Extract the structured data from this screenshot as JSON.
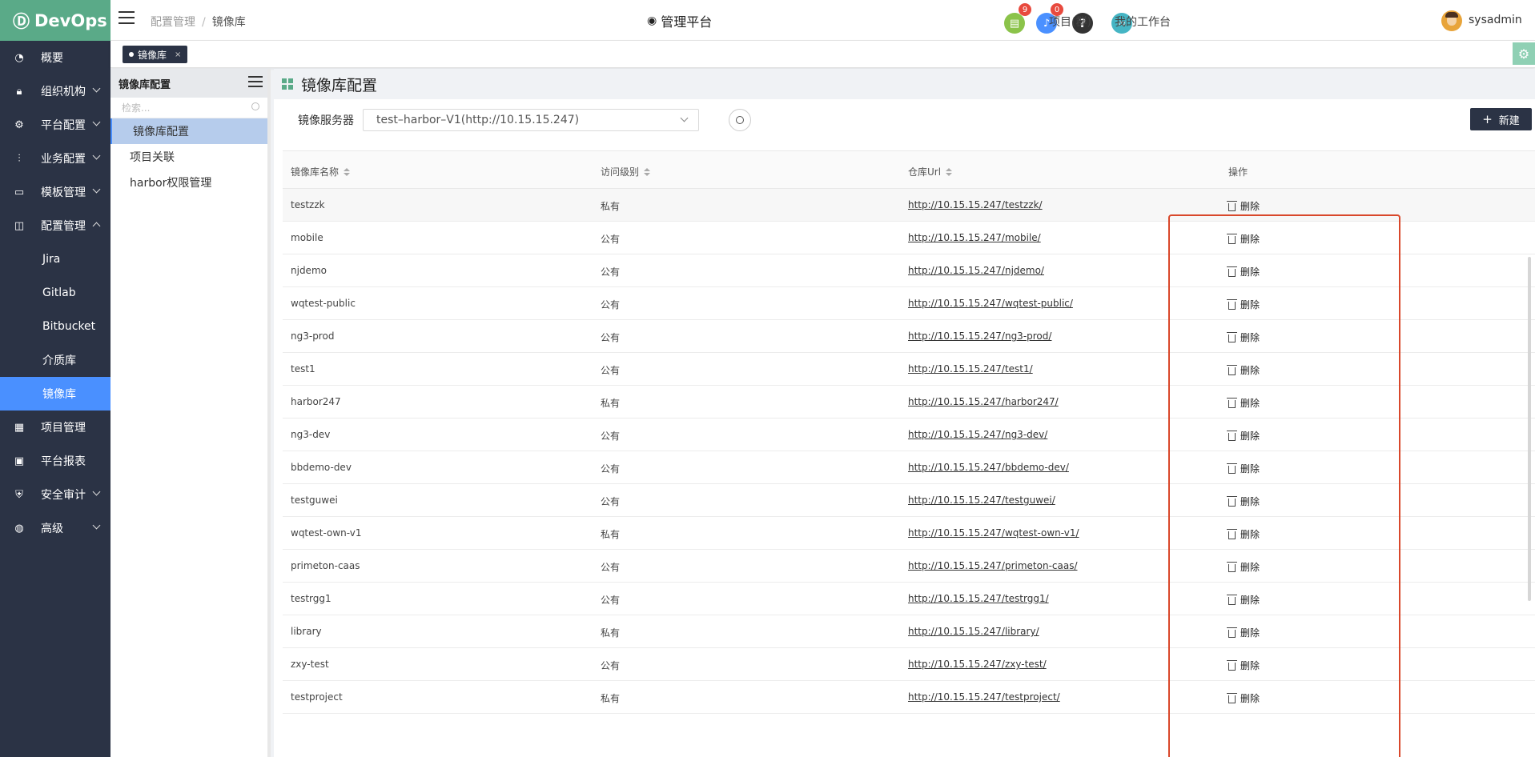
{
  "logo": {
    "text": "DevOps"
  },
  "nav": {
    "items": [
      {
        "label": "概要",
        "icon": "dashboard-icon",
        "chevron": ""
      },
      {
        "label": "组织机构",
        "icon": "lock-icon",
        "chevron": "down"
      },
      {
        "label": "平台配置",
        "icon": "gear-icon",
        "chevron": "down"
      },
      {
        "label": "业务配置",
        "icon": "sliders-icon",
        "chevron": "down"
      },
      {
        "label": "模板管理",
        "icon": "template-icon",
        "chevron": "down"
      },
      {
        "label": "配置管理",
        "icon": "database-icon",
        "chevron": "up"
      }
    ],
    "sub_items": [
      "Jira",
      "Gitlab",
      "Bitbucket",
      "介质库",
      "镜像库"
    ],
    "items_after": [
      {
        "label": "项目管理",
        "icon": "grid-icon",
        "chevron": ""
      },
      {
        "label": "平台报表",
        "icon": "monitor-icon",
        "chevron": ""
      },
      {
        "label": "安全审计",
        "icon": "shield-icon",
        "chevron": "down"
      },
      {
        "label": "高级",
        "icon": "palette-icon",
        "chevron": "down"
      }
    ]
  },
  "header": {
    "breadcrumb_parent": "配置管理",
    "breadcrumb_sep": "/",
    "breadcrumb_current": "镜像库",
    "platform_title": "管理平台",
    "doc_badge": "9",
    "bell_badge": "0",
    "projects_link": "项目(群)",
    "workspace_link": "我的工作台",
    "username": "sysadmin"
  },
  "tabs": {
    "active_tab": "镜像库",
    "close": "×"
  },
  "subpanel": {
    "title": "镜像库配置",
    "search_placeholder": "检索...",
    "links": [
      "镜像库配置",
      "项目关联",
      "harbor权限管理"
    ]
  },
  "main": {
    "title": "镜像库配置",
    "filter_label": "镜像服务器",
    "server_value": "test–harbor–V1(http://10.15.15.247)",
    "new_button": "新建",
    "columns": [
      "镜像库名称",
      "访问级别",
      "仓库Url",
      "操作"
    ],
    "delete_label": "删除",
    "rows": [
      {
        "name": "testzzk",
        "level": "私有",
        "url": "http://10.15.15.247/testzzk/"
      },
      {
        "name": "mobile",
        "level": "公有",
        "url": "http://10.15.15.247/mobile/"
      },
      {
        "name": "njdemo",
        "level": "公有",
        "url": "http://10.15.15.247/njdemo/"
      },
      {
        "name": "wqtest-public",
        "level": "公有",
        "url": "http://10.15.15.247/wqtest-public/"
      },
      {
        "name": "ng3-prod",
        "level": "公有",
        "url": "http://10.15.15.247/ng3-prod/"
      },
      {
        "name": "test1",
        "level": "公有",
        "url": "http://10.15.15.247/test1/"
      },
      {
        "name": "harbor247",
        "level": "私有",
        "url": "http://10.15.15.247/harbor247/"
      },
      {
        "name": "ng3-dev",
        "level": "公有",
        "url": "http://10.15.15.247/ng3-dev/"
      },
      {
        "name": "bbdemo-dev",
        "level": "公有",
        "url": "http://10.15.15.247/bbdemo-dev/"
      },
      {
        "name": "testguwei",
        "level": "公有",
        "url": "http://10.15.15.247/testguwei/"
      },
      {
        "name": "wqtest-own-v1",
        "level": "私有",
        "url": "http://10.15.15.247/wqtest-own-v1/"
      },
      {
        "name": "primeton-caas",
        "level": "公有",
        "url": "http://10.15.15.247/primeton-caas/"
      },
      {
        "name": "testrgg1",
        "level": "公有",
        "url": "http://10.15.15.247/testrgg1/"
      },
      {
        "name": "library",
        "level": "私有",
        "url": "http://10.15.15.247/library/"
      },
      {
        "name": "zxy-test",
        "level": "公有",
        "url": "http://10.15.15.247/zxy-test/"
      },
      {
        "name": "testproject",
        "level": "私有",
        "url": "http://10.15.15.247/testproject/"
      }
    ]
  },
  "colors": {
    "sidebar_bg": "#2b3345",
    "logo_bg": "#5aaa88",
    "active_blue": "#4a90ff",
    "highlight_red": "#d9482b",
    "badge_red": "#e84a3e"
  }
}
